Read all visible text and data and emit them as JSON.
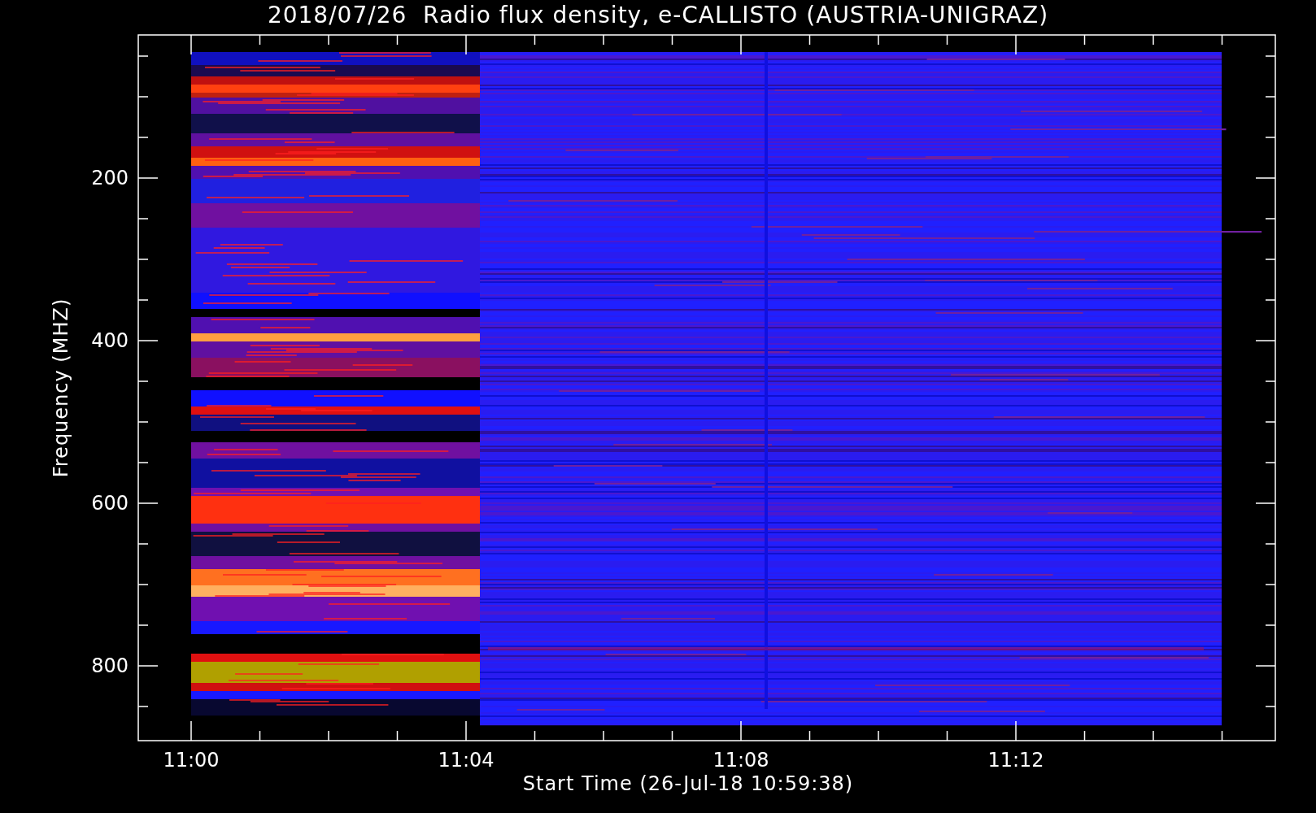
{
  "title": "2018/07/26  Radio flux density, e-CALLISTO (AUSTRIA-UNIGRAZ)",
  "y_axis": {
    "label": "Frequency (MHZ)",
    "ticks": [
      "200",
      "400",
      "600",
      "800"
    ]
  },
  "x_axis": {
    "label": "Start Time (26-Jul-18 10:59:38)",
    "ticks": [
      "11:00",
      "11:04",
      "11:08",
      "11:12"
    ]
  }
}
